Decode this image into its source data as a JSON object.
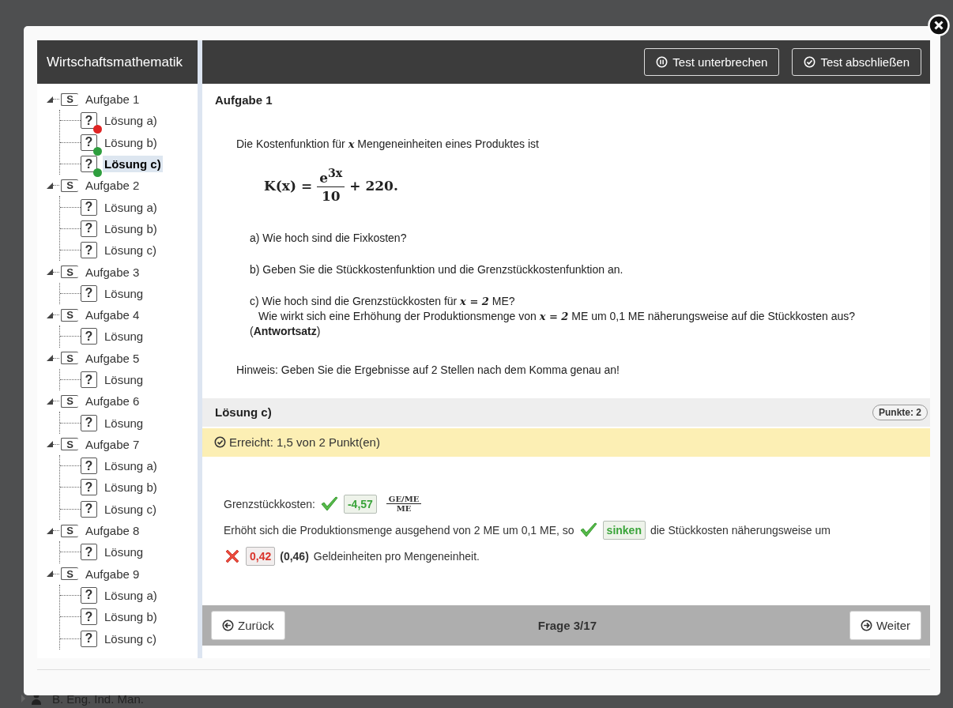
{
  "background": {
    "footer_text": "B. Eng. Ind. Man."
  },
  "sidebar": {
    "title": "Wirtschaftsmathematik",
    "tree": [
      {
        "icon": "S",
        "label": "Aufgabe 1",
        "expanded": true,
        "selected": false,
        "children": [
          {
            "icon": "?",
            "label": "Lösung a)",
            "selected": false,
            "color": "#e02424"
          },
          {
            "icon": "?",
            "label": "Lösung b)",
            "selected": false,
            "color": "#2e9e3e"
          },
          {
            "icon": "?",
            "label": "Lösung c)",
            "selected": true,
            "color": "#2e9e3e"
          }
        ]
      },
      {
        "icon": "S",
        "label": "Aufgabe 2",
        "expanded": true,
        "selected": false,
        "children": [
          {
            "icon": "?",
            "label": "Lösung a)",
            "selected": false
          },
          {
            "icon": "?",
            "label": "Lösung b)",
            "selected": false
          },
          {
            "icon": "?",
            "label": "Lösung c)",
            "selected": false
          }
        ]
      },
      {
        "icon": "S",
        "label": "Aufgabe 3",
        "expanded": true,
        "selected": false,
        "children": [
          {
            "icon": "?",
            "label": "Lösung",
            "selected": false
          }
        ]
      },
      {
        "icon": "S",
        "label": "Aufgabe 4",
        "expanded": true,
        "selected": false,
        "children": [
          {
            "icon": "?",
            "label": "Lösung",
            "selected": false
          }
        ]
      },
      {
        "icon": "S",
        "label": "Aufgabe 5",
        "expanded": true,
        "selected": false,
        "children": [
          {
            "icon": "?",
            "label": "Lösung",
            "selected": false
          }
        ]
      },
      {
        "icon": "S",
        "label": "Aufgabe 6",
        "expanded": true,
        "selected": false,
        "children": [
          {
            "icon": "?",
            "label": "Lösung",
            "selected": false
          }
        ]
      },
      {
        "icon": "S",
        "label": "Aufgabe 7",
        "expanded": true,
        "selected": false,
        "children": [
          {
            "icon": "?",
            "label": "Lösung a)",
            "selected": false
          },
          {
            "icon": "?",
            "label": "Lösung b)",
            "selected": false
          },
          {
            "icon": "?",
            "label": "Lösung c)",
            "selected": false
          }
        ]
      },
      {
        "icon": "S",
        "label": "Aufgabe 8",
        "expanded": true,
        "selected": false,
        "children": [
          {
            "icon": "?",
            "label": "Lösung",
            "selected": false
          }
        ]
      },
      {
        "icon": "S",
        "label": "Aufgabe 9",
        "expanded": true,
        "selected": false,
        "children": [
          {
            "icon": "?",
            "label": "Lösung a)",
            "selected": false
          },
          {
            "icon": "?",
            "label": "Lösung b)",
            "selected": false
          },
          {
            "icon": "?",
            "label": "Lösung c)",
            "selected": false
          }
        ]
      }
    ]
  },
  "header": {
    "buttons": [
      {
        "kind": "pause",
        "label": "Test unterbrechen"
      },
      {
        "kind": "finish",
        "label": "Test abschließen"
      }
    ]
  },
  "question": {
    "title": "Aufgabe 1",
    "intro": "Die Kostenfunktion für *x* Mengeneinheiten eines Produktes ist",
    "formula": {
      "lhs": "K(x) =",
      "numerator": "e$^{3x}$",
      "denominator": "10",
      "rest": "+ 220."
    },
    "parts": [
      "a) Wie hoch sind die Fixkosten?",
      "b) Geben Sie die Stückkostenfunktion und die Grenzstückkostenfunktion an.",
      "c) Wie hoch sind die Grenzstückkosten für *x = 2* ME?"
    ],
    "part_c_continuation": [
      "Wie wirkt sich eine Erhöhung der Produktionsmenge von *x = 2* ME um 0,1 ME näherungsweise auf die Stückkosten aus?",
      "(**Antwortsatz**)"
    ],
    "hint": "Hinweis: Geben Sie die Ergebnisse auf 2 Stellen nach dem Komma genau an!"
  },
  "solution": {
    "title": "Lösung c)",
    "points": "Punkte: 2",
    "result": "Erreicht: 1,5 von 2 Punkt(en)",
    "lines": [
      [
        {
          "kind": "text",
          "text": "Grenzstückkosten:"
        },
        {
          "kind": "answer",
          "value": "-4,57",
          "correct": true
        },
        {
          "kind": "fraction",
          "numerator": "GE/ME",
          "denominator": "ME"
        }
      ],
      [
        {
          "kind": "text",
          "text": "Erhöht sich die Produktionsmenge ausgehend von 2 ME um 0,1 ME, so"
        },
        {
          "kind": "answer",
          "value": "sinken",
          "correct": true
        },
        {
          "kind": "text",
          "text": "die Stückkosten näherungsweise um"
        }
      ],
      [
        {
          "kind": "answer",
          "value": "0,42",
          "correct": false
        },
        {
          "kind": "expected",
          "text": "(0,46)"
        },
        {
          "kind": "text",
          "text": "Geldeinheiten pro Mengeneinheit."
        }
      ]
    ]
  },
  "footer": {
    "back": "Zurück",
    "progress": "Frage 3/17",
    "next": "Weiter"
  }
}
